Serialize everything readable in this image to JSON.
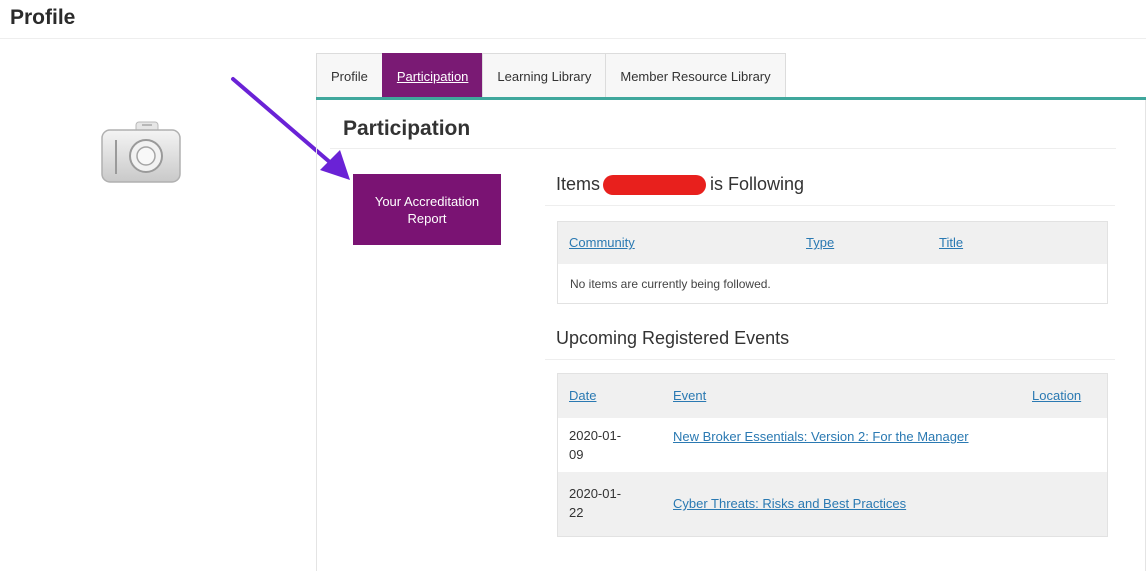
{
  "page": {
    "title": "Profile"
  },
  "tabs": [
    {
      "label": "Profile",
      "active": false
    },
    {
      "label": "Participation",
      "active": true
    },
    {
      "label": "Learning Library",
      "active": false
    },
    {
      "label": "Member Resource Library",
      "active": false
    }
  ],
  "participation": {
    "heading": "Participation",
    "report_button": "Your Accreditation Report",
    "following": {
      "heading_prefix": "Items",
      "heading_suffix": "is Following",
      "columns": [
        "Community",
        "Type",
        "Title"
      ],
      "empty_message": "No items are currently being followed."
    },
    "events": {
      "heading": "Upcoming Registered Events",
      "columns": [
        "Date",
        "Event",
        "Location"
      ],
      "rows": [
        {
          "date_line1": "2020-01-",
          "date_line2": "09",
          "event": "New Broker Essentials: Version 2: For the Manager"
        },
        {
          "date_line1": "2020-01-",
          "date_line2": "22",
          "event": "Cyber Threats: Risks and Best Practices"
        }
      ]
    }
  },
  "colors": {
    "accent": "#7a1373",
    "tab_rule": "#3fa79c",
    "link": "#2a79b2",
    "redaction": "#e8201d",
    "annotation_arrow": "#6a22d6"
  },
  "icons": {
    "avatar": "camera-icon",
    "annotation": "arrow-annotation"
  }
}
